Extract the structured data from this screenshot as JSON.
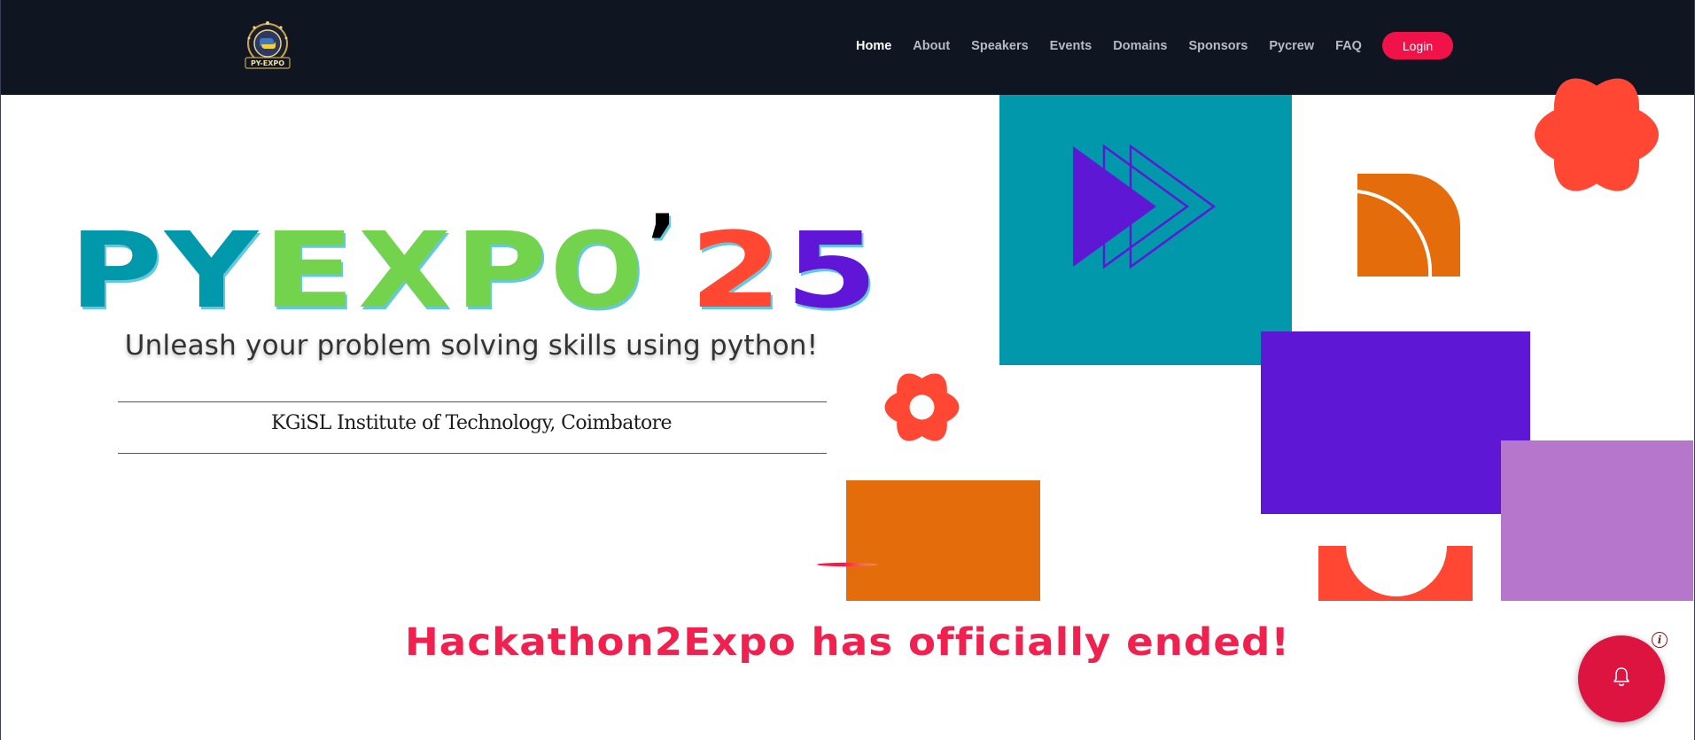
{
  "nav": {
    "logo_label": "PY-EXPO",
    "links": [
      "Home",
      "About",
      "Speakers",
      "Events",
      "Domains",
      "Sponsors",
      "Pycrew",
      "FAQ"
    ],
    "active": "Home",
    "login_label": "Login"
  },
  "hero": {
    "title": "PYEXPO'25",
    "tagline": "Unleash your problem solving skills using python!",
    "institute": "KGiSL Institute of Technology, Coimbatore",
    "status": "Hackathon2Expo has officially ended!"
  },
  "notification": {
    "icon": "bell-icon",
    "badge": "i"
  },
  "colors": {
    "teal": "#0298ab",
    "green": "#73d34e",
    "red": "#ff4733",
    "purple": "#5f17d6",
    "orange": "#e56c0a",
    "lilac": "#b676cc",
    "nav_bg": "#101522",
    "accent": "#f2124a"
  }
}
